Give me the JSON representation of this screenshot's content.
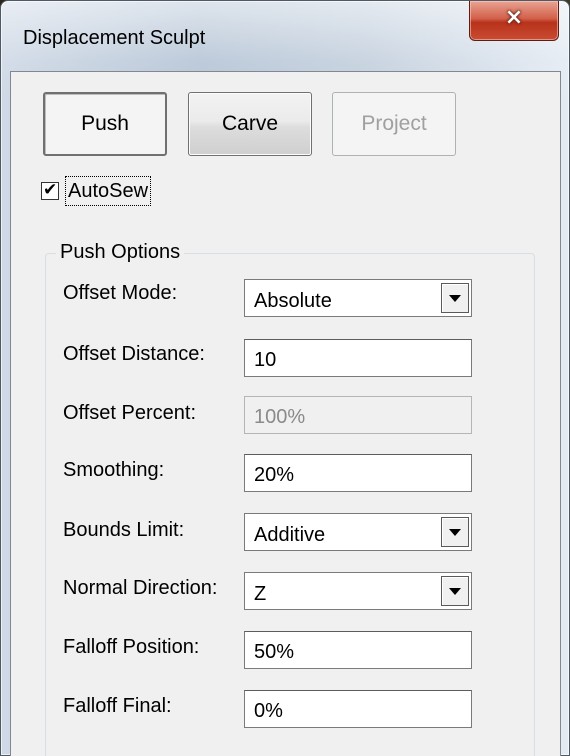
{
  "window": {
    "title": "Displacement Sculpt",
    "close_icon": "×"
  },
  "mode_buttons": {
    "push": "Push",
    "carve": "Carve",
    "project": "Project"
  },
  "autosew": {
    "label": "AutoSew",
    "checked": true,
    "check_mark": "✔"
  },
  "push_options": {
    "title": "Push Options",
    "offset_mode": {
      "label": "Offset Mode:",
      "value": "Absolute"
    },
    "offset_distance": {
      "label": "Offset Distance:",
      "value": "10"
    },
    "offset_percent": {
      "label": "Offset Percent:",
      "value": "100%"
    },
    "smoothing": {
      "label": "Smoothing:",
      "value": "20%"
    },
    "bounds_limit": {
      "label": "Bounds Limit:",
      "value": "Additive"
    },
    "normal_direction": {
      "label": "Normal Direction:",
      "value": "Z"
    },
    "falloff_position": {
      "label": "Falloff Position:",
      "value": "50%"
    },
    "falloff_final": {
      "label": "Falloff Final:",
      "value": "0%"
    }
  }
}
